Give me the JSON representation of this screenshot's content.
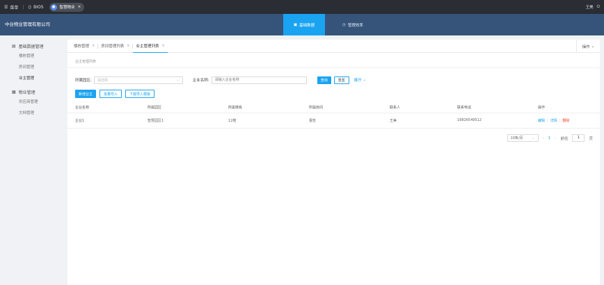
{
  "topbar": {
    "menu_label": "菜单",
    "bios_label": "BIOS",
    "app_tab_label": "智慧物业",
    "user_name": "王美"
  },
  "header": {
    "company": "中台物业管理有限公司",
    "nav": [
      {
        "label": "基础数据",
        "active": true
      },
      {
        "label": "管理效率",
        "active": false
      }
    ]
  },
  "sidebar": {
    "groups": [
      {
        "label": "基础数据管理",
        "items": [
          "楼栋管理",
          "房间管理",
          "业主管理"
        ]
      },
      {
        "label": "物业管理",
        "items": [
          "供应商管理",
          "文档管理"
        ]
      }
    ]
  },
  "tabs": [
    {
      "label": "楼栋管理",
      "active": false
    },
    {
      "label": "房间管理列表",
      "active": false
    },
    {
      "label": "业主管理列表",
      "active": true
    }
  ],
  "ops_label": "操作",
  "breadcrumb": "业主管理列表",
  "filters": {
    "park_label": "所属园区:",
    "park_placeholder": "请选择",
    "company_label": "企业名称:",
    "company_placeholder": "请输入企业名称",
    "query_label": "查询",
    "reset_label": "重置",
    "expand_label": "展开"
  },
  "actions": {
    "add_label": "新增业主",
    "import_label": "批量导入",
    "template_label": "下载导入模板"
  },
  "table": {
    "columns": [
      "企业名称",
      "所属园区",
      "所属楼栋",
      "所属房间",
      "联系人",
      "联系电话",
      "操作"
    ],
    "rows": [
      {
        "name": "企业1",
        "park": "智慧园区1",
        "building": "12楼",
        "room": "报告",
        "contact": "王美",
        "phone": "18826549512"
      }
    ],
    "row_ops": {
      "edit": "编辑",
      "detail": "详情",
      "delete": "删除"
    }
  },
  "pager": {
    "page_size": "10条/页",
    "current_page": "1",
    "goto_label": "前往",
    "goto_value": "1",
    "page_unit": "页"
  }
}
